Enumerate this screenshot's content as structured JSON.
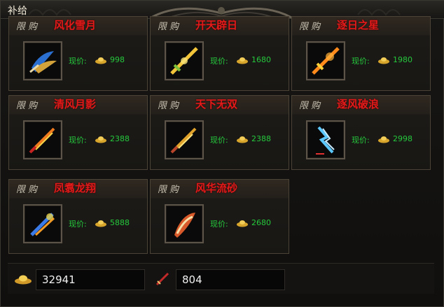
{
  "window": {
    "title": "补给"
  },
  "colors": {
    "name_red": "#e21a1a",
    "price_green": "#25c93c",
    "panel_border": "#4a4336"
  },
  "items": [
    {
      "badge": "限购",
      "name": "风化雪月",
      "price_label": "现价:",
      "price": "998",
      "icon": "ice-blade-icon"
    },
    {
      "badge": "限购",
      "name": "开天辟日",
      "price_label": "现价:",
      "price": "1680",
      "icon": "golden-sword-icon"
    },
    {
      "badge": "限购",
      "name": "逐日之星",
      "price_label": "现价:",
      "price": "1980",
      "icon": "fire-sword-icon"
    },
    {
      "badge": "限购",
      "name": "清风月影",
      "price_label": "现价:",
      "price": "2388",
      "icon": "flame-blade-icon"
    },
    {
      "badge": "限购",
      "name": "天下无双",
      "price_label": "现价:",
      "price": "2388",
      "icon": "gold-blade-icon"
    },
    {
      "badge": "限购",
      "name": "逐风破浪",
      "price_label": "现价:",
      "price": "2998",
      "icon": "lightning-blade-icon"
    },
    {
      "badge": "限购",
      "name": "凤翥龙翔",
      "price_label": "现价:",
      "price": "5888",
      "icon": "phoenix-blade-icon"
    },
    {
      "badge": "限购",
      "name": "风华流砂",
      "price_label": "现价:",
      "price": "2680",
      "icon": "sand-blade-icon"
    }
  ],
  "footer": {
    "gold": "32941",
    "token": "804",
    "gold_icon": "gold-ingot-icon",
    "token_icon": "red-sword-icon"
  }
}
